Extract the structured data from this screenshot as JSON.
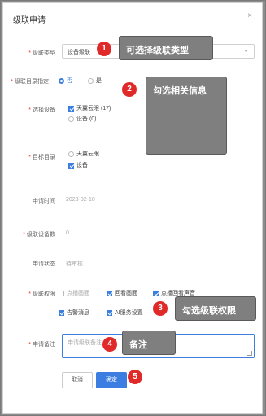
{
  "dialog": {
    "title": "级联申请",
    "close": "×"
  },
  "cascade_type": {
    "label": "级联类型",
    "value": "设备级联",
    "chevron": "⌄"
  },
  "directory_spec": {
    "label": "级联目录指定",
    "options": [
      "否",
      "是"
    ]
  },
  "select_device": {
    "label": "选择设备",
    "options": [
      "天翼云眼 (17)",
      "设备 (0)"
    ]
  },
  "target_directory": {
    "label": "目标目录",
    "options": [
      "天翼云眼",
      "设备"
    ]
  },
  "apply_time": {
    "label": "申请时间",
    "value": "2023-02-10"
  },
  "device_count": {
    "label": "级联设备数",
    "value": "0"
  },
  "apply_status": {
    "label": "申请状态",
    "value": "待审核"
  },
  "permissions": {
    "label": "级联权限",
    "items": [
      "点播画面",
      "回看画面",
      "点播回看声音",
      "告警消息",
      "AI服务设置"
    ]
  },
  "remark": {
    "label": "申请备注",
    "placeholder": "申请级联备注"
  },
  "buttons": {
    "cancel": "取消",
    "confirm": "确定"
  },
  "annotations": [
    {
      "num": "1",
      "text": "可选择级联类型"
    },
    {
      "num": "2",
      "text": "勾选相关信息"
    },
    {
      "num": "3",
      "text": "勾选级联权限"
    },
    {
      "num": "4",
      "text": "备注"
    },
    {
      "num": "5",
      "text": ""
    }
  ],
  "colors": {
    "accent": "#3b7de0",
    "badge": "#e02a2a",
    "tip_bg": "#7f7f7f",
    "overlay": "#8c8c8c"
  }
}
